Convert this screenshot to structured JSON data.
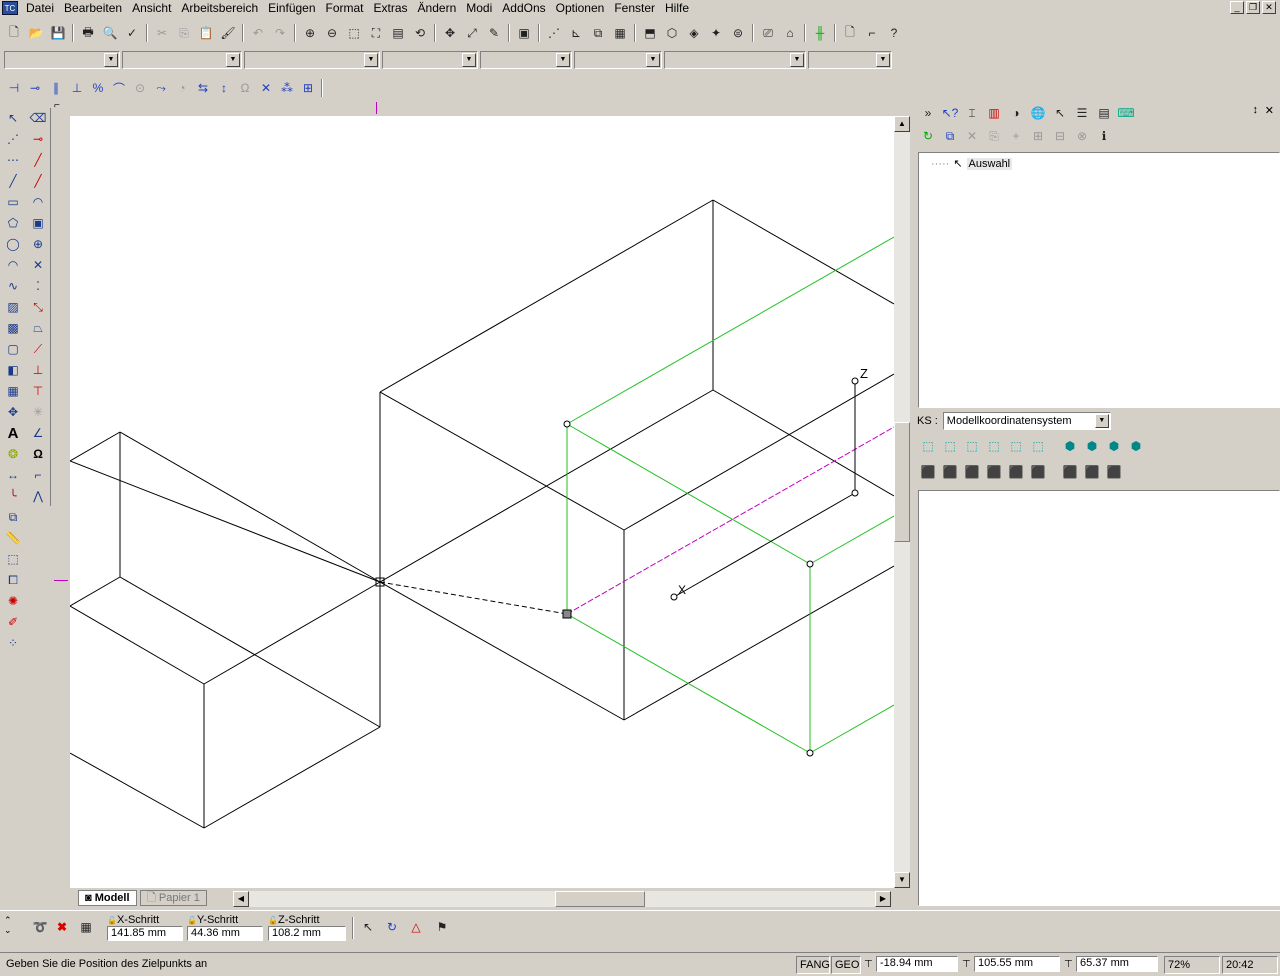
{
  "app": {
    "icon_label": "TC"
  },
  "menu": [
    "Datei",
    "Bearbeiten",
    "Ansicht",
    "Arbeitsbereich",
    "Einfügen",
    "Format",
    "Extras",
    "Ändern",
    "Modi",
    "AddOns",
    "Optionen",
    "Fenster",
    "Hilfe"
  ],
  "tabs": {
    "model": "Modell",
    "paper": "Papier 1"
  },
  "coordsys": {
    "label": "KS :",
    "value": "Modellkoordinatensystem"
  },
  "tree": {
    "root": "Auswahl"
  },
  "canvas": {
    "axis_z": "Z",
    "axis_x": "X"
  },
  "steps": {
    "x_label": "X-Schritt",
    "x_value": "141.85 mm",
    "y_label": "Y-Schritt",
    "y_value": "44.36 mm",
    "z_label": "Z-Schritt",
    "z_value": "108.2 mm"
  },
  "status": {
    "prompt": "Geben Sie die Position des Zielpunkts an",
    "fang": "FANG",
    "geo": "GEO",
    "x": "-18.94 mm",
    "y": "105.55 mm",
    "z": "65.37 mm",
    "zoom": "72%",
    "time": "20:42"
  }
}
